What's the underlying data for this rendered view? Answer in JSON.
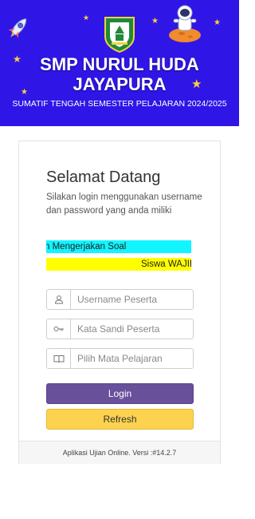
{
  "header": {
    "school_name_line1": "SMP NURUL HUDA",
    "school_name_line2": "JAYAPURA",
    "subtitle": "SUMATIF TENGAH SEMESTER PELAJARAN 2024/2025",
    "colors": {
      "background": "#2f16e6",
      "star": "#ffd23c"
    },
    "icons": [
      "rocket-icon",
      "astronaut-icon",
      "school-logo"
    ]
  },
  "login": {
    "title": "Selamat Datang",
    "description": "Silakan login menggunakan username dan password yang anda miliki",
    "marquee_text_1": "n Mengerjakan Soal",
    "marquee_text_2": "Siswa WAJIB",
    "username_placeholder": "Username Peserta",
    "password_placeholder": "Kata Sandi Peserta",
    "subject_placeholder": "Pilih Mata Pelajaran",
    "login_label": "Login",
    "refresh_label": "Refresh",
    "colors": {
      "login": "#68509b",
      "refresh": "#fdd24f",
      "marquee1": "#12f4ff",
      "marquee2": "#ffff00"
    },
    "field_icons": [
      "user-icon",
      "key-icon",
      "book-icon"
    ]
  },
  "footer": {
    "version_text": "Aplikasi Ujian Online. Versi :#14.2.7"
  }
}
